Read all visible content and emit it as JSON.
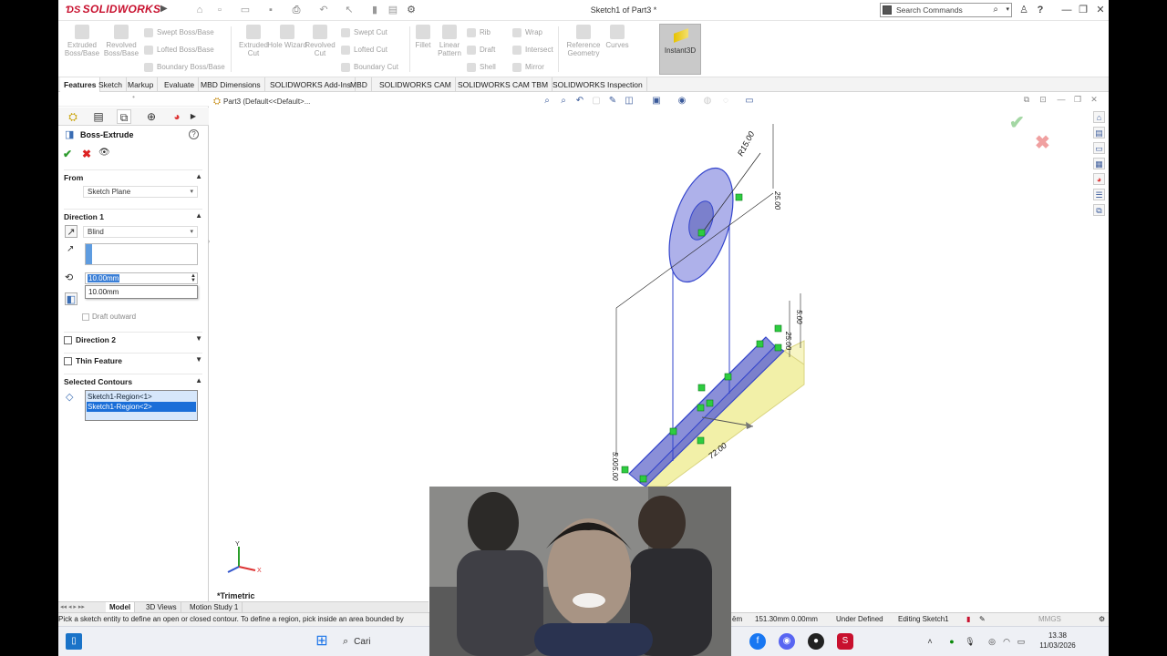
{
  "app": {
    "brand": "SOLIDWORKS",
    "document_title": "Sketch1 of Part3 *",
    "search_placeholder": "Search Commands"
  },
  "command_manager": {
    "buttons": [
      {
        "label": "Extruded Boss/Base"
      },
      {
        "label": "Revolved Boss/Base"
      },
      {
        "label": "Extruded Cut"
      },
      {
        "label": "Hole Wizard"
      },
      {
        "label": "Revolved Cut"
      },
      {
        "label": "Fillet"
      },
      {
        "label": "Linear Pattern"
      },
      {
        "label": "Reference Geometry"
      },
      {
        "label": "Curves"
      },
      {
        "label": "Instant3D"
      }
    ],
    "small_buttons": {
      "swept_boss": "Swept Boss/Base",
      "lofted_boss": "Lofted Boss/Base",
      "boundary_boss": "Boundary Boss/Base",
      "swept_cut": "Swept Cut",
      "lofted_cut": "Lofted Cut",
      "boundary_cut": "Boundary Cut",
      "rib": "Rib",
      "draft": "Draft",
      "shell": "Shell",
      "wrap": "Wrap",
      "intersect": "Intersect",
      "mirror": "Mirror"
    }
  },
  "tabs": [
    "Features",
    "Sketch",
    "Markup",
    "Evaluate",
    "MBD Dimensions",
    "SOLIDWORKS Add-Ins",
    "MBD",
    "SOLIDWORKS CAM",
    "SOLIDWORKS CAM TBM",
    "SOLIDWORKS Inspection"
  ],
  "property_manager": {
    "title": "Boss-Extrude",
    "from": {
      "heading": "From",
      "value": "Sketch Plane"
    },
    "direction1": {
      "heading": "Direction 1",
      "end_condition": "Blind",
      "depth": "10.00mm",
      "depth_suggestion": "10.00mm",
      "draft_outward": "Draft outward"
    },
    "direction2": {
      "heading": "Direction 2"
    },
    "thin_feature": {
      "heading": "Thin Feature"
    },
    "selected_contours": {
      "heading": "Selected Contours",
      "items": [
        "Sketch1-Region<1>",
        "Sketch1-Region<2>"
      ]
    }
  },
  "graphics": {
    "breadcrumb": "Part3 (Default<<Default>...",
    "view_name": "*Trimetric",
    "dims": {
      "radius": "R15.00",
      "length": "72.00",
      "d1": "25.00",
      "d2": "5.00",
      "d3": "25.00",
      "d4": "5.00",
      "d5": "5.00"
    }
  },
  "model_tabs": [
    "Model",
    "3D Views",
    "Motion Study 1"
  ],
  "status_bar": {
    "message": "Pick a sketch entity to define an open or closed contour. To define a region, pick inside an area bounded by",
    "unit_hint": "ēm",
    "coords": "151.30mm  0.00mm",
    "state": "Under Defined",
    "editing": "Editing Sketch1",
    "units": "MMGS"
  },
  "taskbar": {
    "search": "Cari",
    "time": "13.38",
    "date": "11/03/2026"
  },
  "colors": {
    "brand_red": "#c8102e",
    "selection_blue": "#1a6ed8",
    "model_yellow": "#f2f0a8",
    "sketch_blue": "#3344cc",
    "green_handle": "#2ecc40"
  }
}
